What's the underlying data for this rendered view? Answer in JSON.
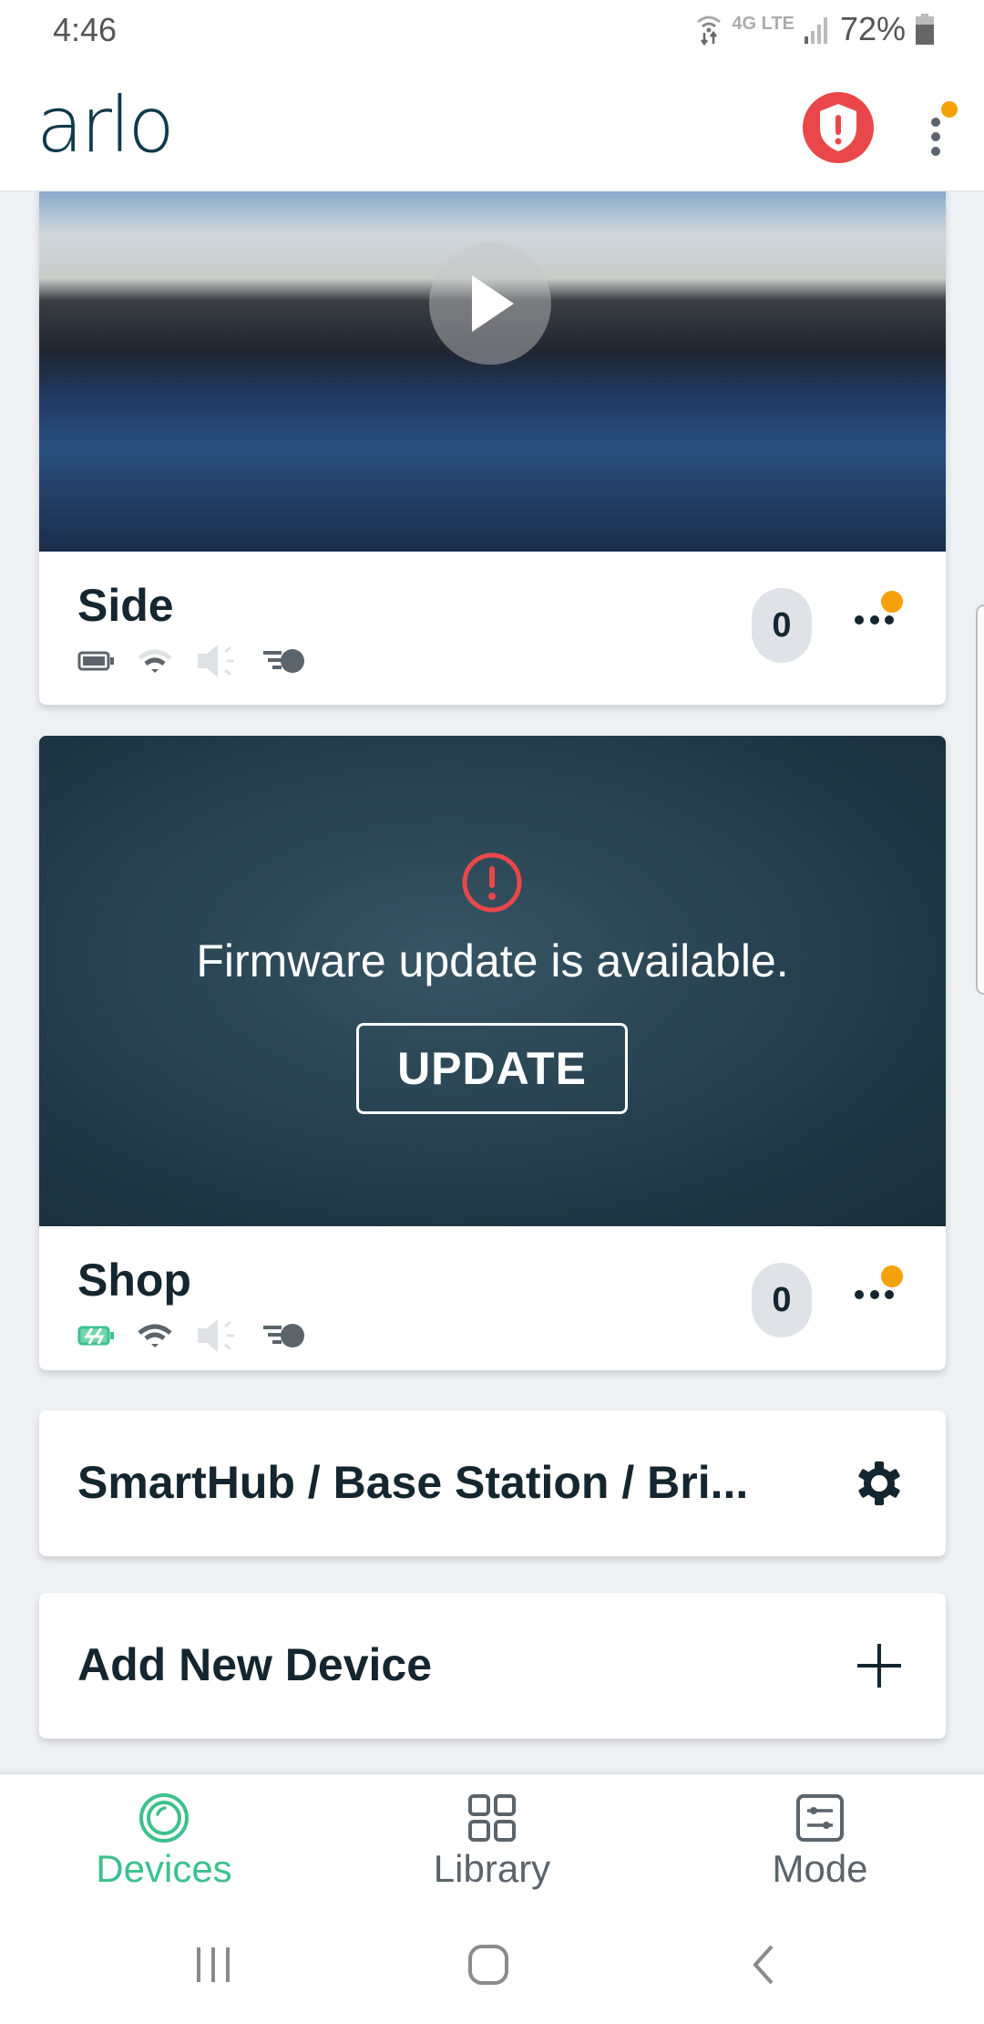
{
  "status_bar": {
    "time": "4:46",
    "network": "4G LTE",
    "battery_percent": "72%",
    "icons": [
      "wifi-calling-icon",
      "4g-lte-icon",
      "signal-icon",
      "battery-icon"
    ]
  },
  "header": {
    "logo": "arlo",
    "alert_icon": "shield-alert-icon",
    "menu_icon": "more-vertical-icon",
    "notification_dot_color": "#f5a20a"
  },
  "colors": {
    "accent": "#3cc08d",
    "alert": "#e9474a",
    "text_dark": "#14262f",
    "notification": "#f5a20a",
    "badge_bg": "#dfe3e7"
  },
  "cameras": [
    {
      "name": "Side",
      "motion_count": "0",
      "battery_state": "normal",
      "wifi_state": "weak",
      "audio_state": "disabled",
      "motion_detection": "on",
      "has_play_button": true,
      "has_notification": true
    },
    {
      "name": "Shop",
      "motion_count": "0",
      "battery_state": "charging",
      "wifi_state": "good",
      "audio_state": "disabled",
      "motion_detection": "on",
      "firmware_message": "Firmware update is available.",
      "update_label": "UPDATE",
      "has_notification": true
    }
  ],
  "rows": {
    "smarthub_label": "SmartHub / Base Station / Bri...",
    "add_device_label": "Add New Device"
  },
  "bottom_nav": {
    "items": [
      {
        "label": "Devices",
        "icon": "devices-icon",
        "active": true
      },
      {
        "label": "Library",
        "icon": "library-grid-icon",
        "active": false
      },
      {
        "label": "Mode",
        "icon": "mode-sliders-icon",
        "active": false
      }
    ]
  },
  "system_nav": [
    "recent-apps-icon",
    "home-icon",
    "back-icon"
  ]
}
